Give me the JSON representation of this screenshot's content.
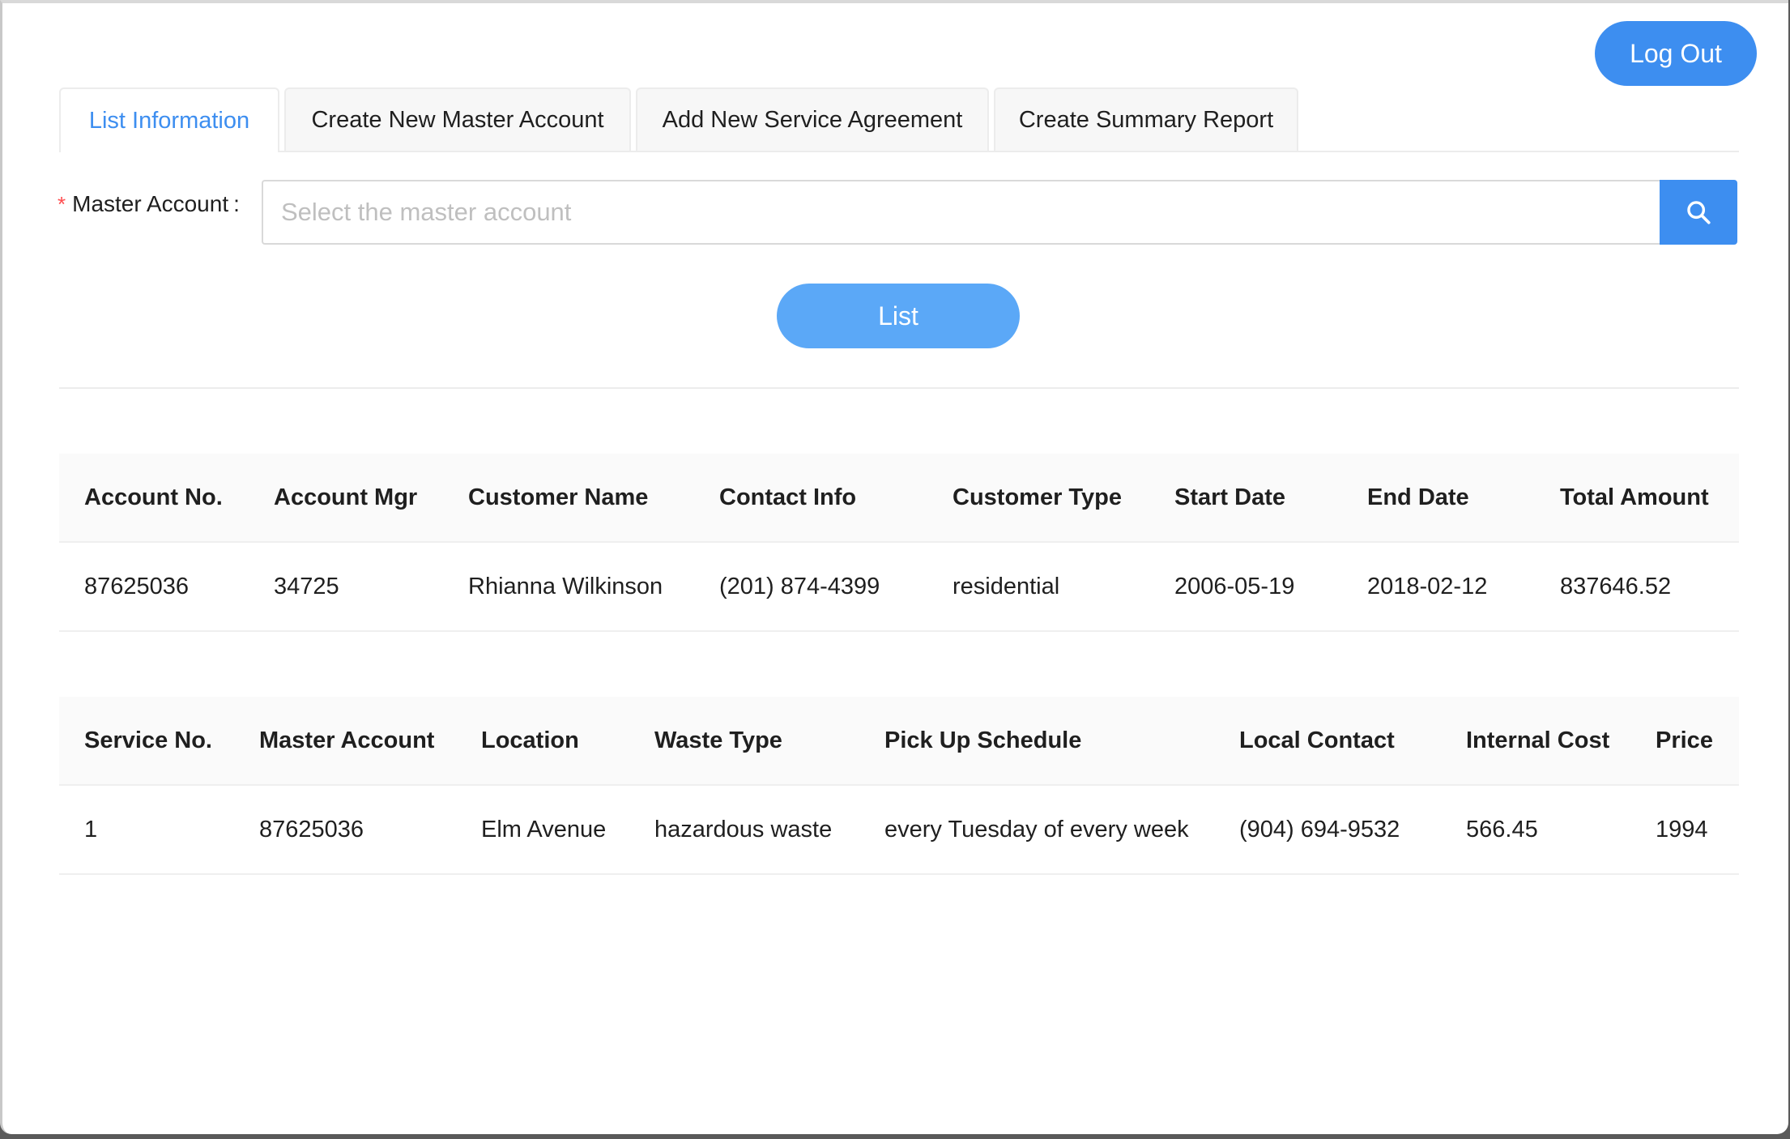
{
  "header": {
    "logout_label": "Log Out"
  },
  "tabs": [
    {
      "label": "List Information",
      "active": true
    },
    {
      "label": "Create New Master Account",
      "active": false
    },
    {
      "label": "Add New Service Agreement",
      "active": false
    },
    {
      "label": "Create Summary Report",
      "active": false
    }
  ],
  "form": {
    "required_mark": "*",
    "master_account_label": "Master Account",
    "label_colon": ":",
    "master_account_value": "",
    "master_account_placeholder": "Select the master account",
    "search_icon": "search-icon",
    "list_button_label": "List"
  },
  "accounts_table": {
    "columns": [
      "Account No.",
      "Account Mgr",
      "Customer Name",
      "Contact Info",
      "Customer Type",
      "Start Date",
      "End Date",
      "Total Amount"
    ],
    "rows": [
      [
        "87625036",
        "34725",
        "Rhianna Wilkinson",
        "(201) 874-4399",
        "residential",
        "2006-05-19",
        "2018-02-12",
        "837646.52"
      ]
    ]
  },
  "services_table": {
    "columns": [
      "Service No.",
      "Master Account",
      "Location",
      "Waste Type",
      "Pick Up Schedule",
      "Local Contact",
      "Internal Cost",
      "Price"
    ],
    "rows": [
      [
        "1",
        "87625036",
        "Elm Avenue",
        "hazardous waste",
        "every Tuesday of every week",
        "(904) 694-9532",
        "566.45",
        "1994"
      ]
    ]
  },
  "colors": {
    "accent": "#3d8ef0",
    "list_button": "#5ba8f7",
    "required": "#ff4d4f",
    "header_bg": "#fafafa"
  }
}
